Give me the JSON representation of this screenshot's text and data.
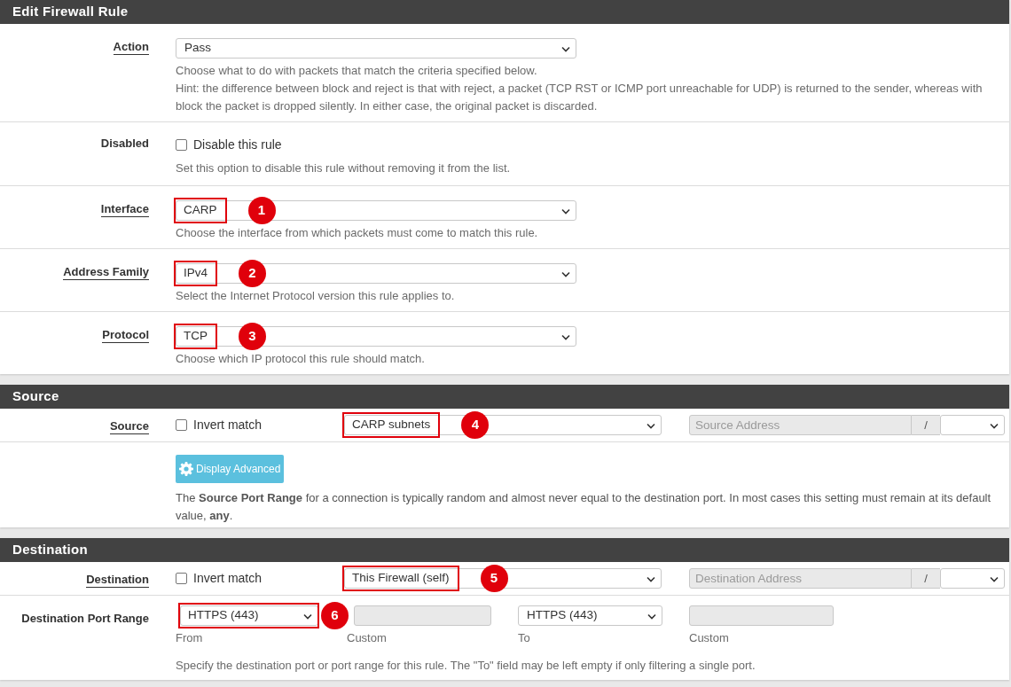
{
  "sections": [
    {
      "title": "Edit Firewall Rule",
      "rows": [
        {
          "kind": "select",
          "label": "Action",
          "underlined": true,
          "value": "Pass",
          "highlighted": false,
          "help": [
            "Choose what to do with packets that match the criteria specified below.",
            "Hint: the difference between block and reject is that with reject, a packet (TCP RST or ICMP port unreachable for UDP) is returned to the sender, whereas with block the packet is dropped silently. In either case, the original packet is discarded."
          ]
        },
        {
          "kind": "checkbox",
          "label": "Disabled",
          "underlined": false,
          "checked": false,
          "text": "Disable this rule",
          "help": [
            "Set this option to disable this rule without removing it from the list."
          ]
        },
        {
          "kind": "select",
          "label": "Interface",
          "underlined": true,
          "value": "CARP",
          "highlighted": true,
          "callout": "1",
          "help": [
            "Choose the interface from which packets must come to match this rule."
          ]
        },
        {
          "kind": "select",
          "label": "Address Family",
          "underlined": true,
          "value": "IPv4",
          "highlighted": true,
          "callout": "2",
          "help": [
            "Select the Internet Protocol version this rule applies to."
          ]
        },
        {
          "kind": "select",
          "label": "Protocol",
          "underlined": true,
          "value": "TCP",
          "highlighted": true,
          "callout": "3",
          "help": [
            "Choose which IP protocol this rule should match."
          ]
        }
      ]
    },
    {
      "title": "Source",
      "rows": [
        {
          "kind": "endpoint",
          "label": "Source",
          "underlined": true,
          "checked": false,
          "text": "Invert match",
          "value": "CARP subnets",
          "highlighted": true,
          "callout": "4",
          "address_placeholder": "Source Address",
          "slash": "/"
        },
        {
          "kind": "advanced",
          "button": "Display Advanced",
          "help": [
            "The **Source Port Range** for a connection is typically random and almost never equal to the destination port. In most cases this setting must remain at its default value, **any**."
          ]
        }
      ]
    },
    {
      "title": "Destination",
      "rows": [
        {
          "kind": "endpoint",
          "label": "Destination",
          "underlined": true,
          "checked": false,
          "text": "Invert match",
          "value": "This Firewall (self)",
          "highlighted": true,
          "callout": "5",
          "address_placeholder": "Destination Address",
          "slash": "/"
        },
        {
          "kind": "ports",
          "label": "Destination Port Range",
          "underlined": false,
          "fields": [
            {
              "kind": "select",
              "value": "HTTPS (443)",
              "highlighted": true,
              "callout": "6",
              "caption": "From"
            },
            {
              "kind": "input",
              "caption": "Custom"
            },
            {
              "kind": "select",
              "value": "HTTPS (443)",
              "highlighted": false,
              "caption": "To"
            },
            {
              "kind": "input",
              "caption": "Custom"
            }
          ],
          "help": [
            "Specify the destination port or port range for this rule. The \"To\" field may be left empty if only filtering a single port."
          ]
        }
      ]
    }
  ]
}
